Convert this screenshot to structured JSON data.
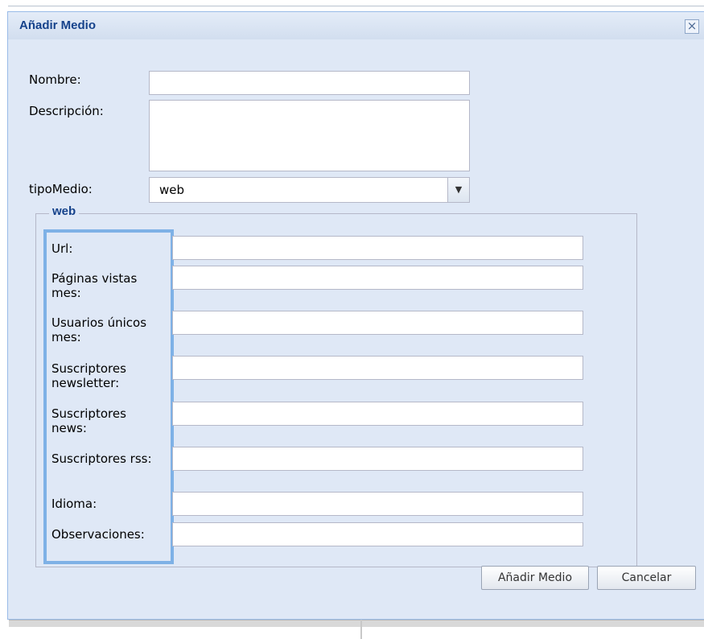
{
  "dialog": {
    "title": "Añadir Medio",
    "close_symbol": "×"
  },
  "form": {
    "nombre_label": "Nombre:",
    "nombre_value": "",
    "descripcion_label": "Descripción:",
    "descripcion_value": "",
    "tipo_label": "tipoMedio:",
    "tipo_value": "web"
  },
  "web": {
    "legend": "web",
    "fields": [
      {
        "label": "Url:",
        "value": ""
      },
      {
        "label": "Páginas vistas mes:",
        "value": ""
      },
      {
        "label": "Usuarios únicos mes:",
        "value": ""
      },
      {
        "label": "Suscriptores newsletter:",
        "value": ""
      },
      {
        "label": "Suscriptores news:",
        "value": ""
      },
      {
        "label": "Suscriptores rss:",
        "value": ""
      },
      {
        "label": "Idioma:",
        "value": ""
      },
      {
        "label": "Observaciones:",
        "value": ""
      }
    ]
  },
  "buttons": {
    "add": "Añadir Medio",
    "cancel": "Cancelar"
  },
  "colors": {
    "dialog_background": "#dfe8f6",
    "title_text": "#15428b",
    "highlight_border": "#7eb1e6"
  },
  "icons": {
    "close": "close-icon",
    "dropdown": "chevron-down-icon"
  }
}
